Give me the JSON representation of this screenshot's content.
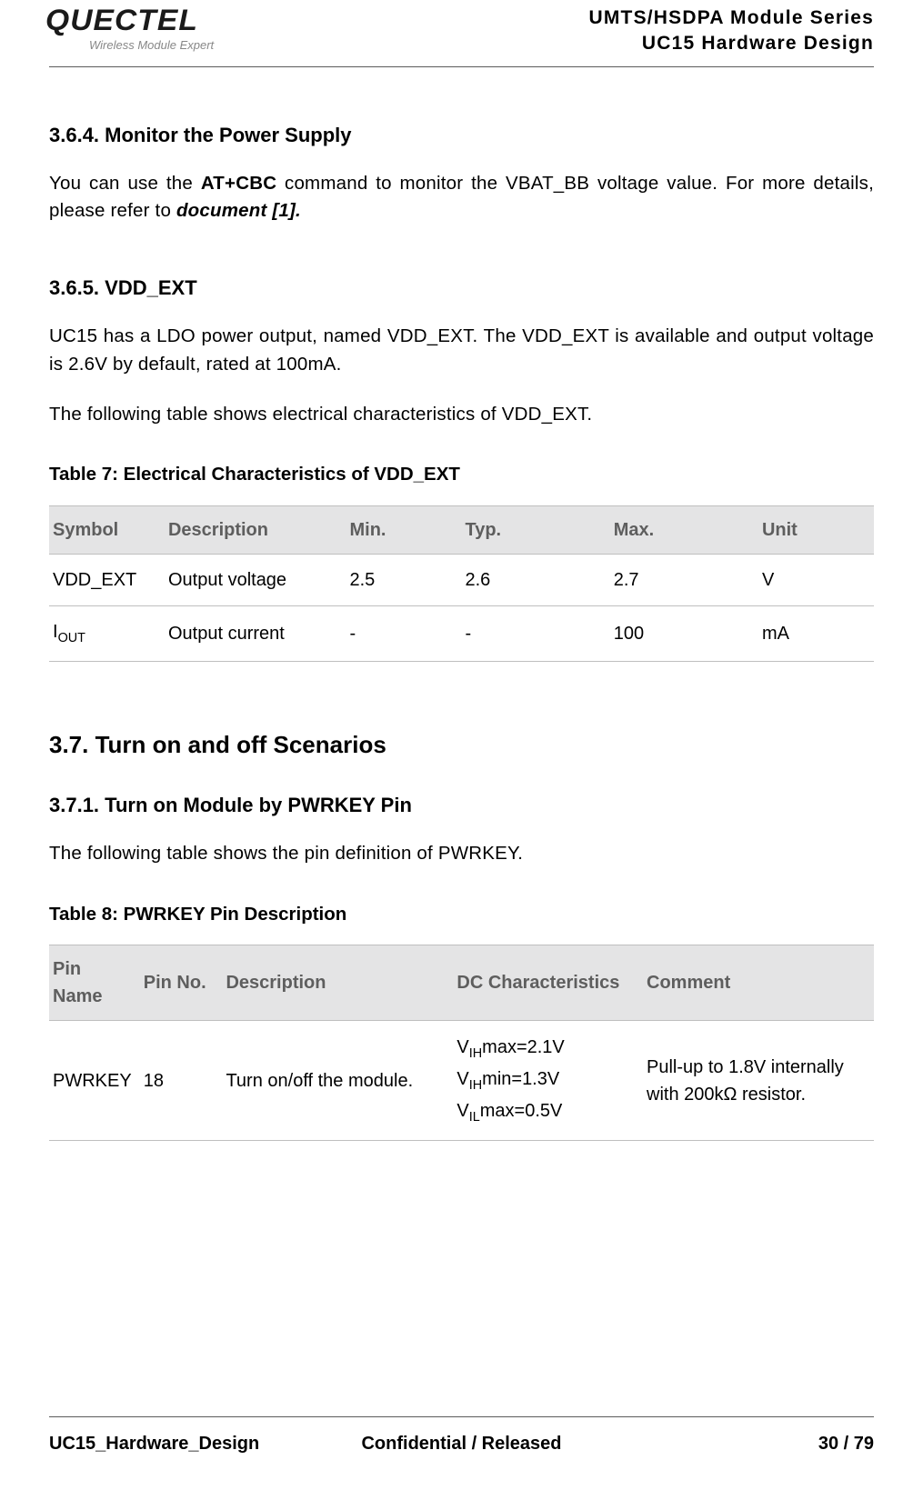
{
  "header": {
    "logo_main": "QUECTEL",
    "logo_sub": "Wireless Module Expert",
    "line1": "UMTS/HSDPA Module Series",
    "line2": "UC15 Hardware Design"
  },
  "s364": {
    "heading": "3.6.4.    Monitor the Power Supply",
    "p_pre": "You can use the ",
    "p_cmd": "AT+CBC",
    "p_mid": " command to monitor the VBAT_BB voltage value. For more details, please refer to ",
    "p_doc": "document [1]."
  },
  "s365": {
    "heading": "3.6.5.    VDD_EXT",
    "p1": "UC15 has a LDO power output, named VDD_EXT. The VDD_EXT is available and output voltage is 2.6V by default, rated at 100mA.",
    "p2": "The following table shows electrical characteristics of VDD_EXT."
  },
  "table7": {
    "caption": "Table 7: Electrical Characteristics of VDD_EXT",
    "headers": [
      "Symbol",
      "Description",
      "Min.",
      "Typ.",
      "Max.",
      "Unit"
    ],
    "rows": [
      {
        "symbol_html": "VDD_EXT",
        "desc": "Output voltage",
        "min": "2.5",
        "typ": "2.6",
        "max": "2.7",
        "unit": "V"
      },
      {
        "symbol_html": "I<sub>OUT</sub>",
        "desc": "Output current",
        "min": "-",
        "typ": "-",
        "max": "100",
        "unit": "mA"
      }
    ]
  },
  "s37": {
    "heading": "3.7. Turn on and off Scenarios"
  },
  "s371": {
    "heading": "3.7.1.    Turn on Module by PWRKEY Pin",
    "p1": "The following table shows the pin definition of PWRKEY."
  },
  "table8": {
    "caption": "Table 8: PWRKEY Pin Description",
    "headers": [
      "Pin Name",
      "Pin No.",
      "Description",
      "DC Characteristics",
      "Comment"
    ],
    "rows": [
      {
        "pin_name": "PWRKEY",
        "pin_no": "18",
        "desc": "Turn on/off the module.",
        "dc_html": "V<sub>IH</sub>max=2.1V<br>V<sub>IH</sub>min=1.3V<br>V<sub>IL</sub>max=0.5V",
        "comment": "Pull-up to 1.8V internally with 200kΩ resistor."
      }
    ]
  },
  "footer": {
    "left": "UC15_Hardware_Design",
    "center": "Confidential / Released",
    "right": "30 / 79"
  }
}
